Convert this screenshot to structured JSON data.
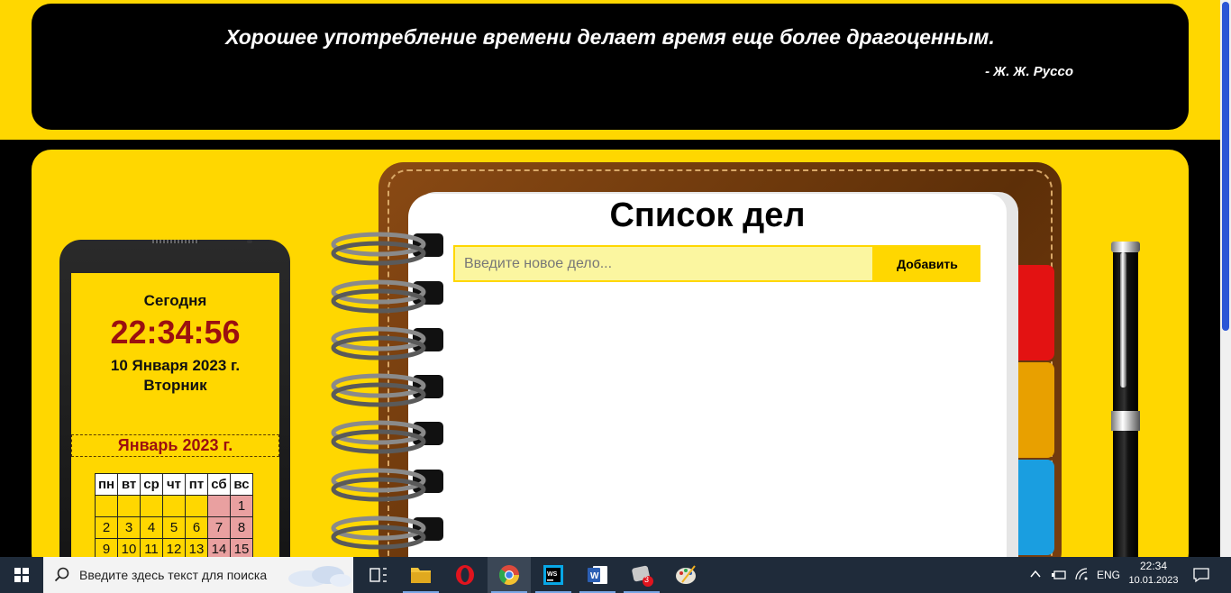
{
  "quote": {
    "text": "Хорошее употребление времени делает время еще более драгоценным.",
    "author": "- Ж. Ж. Руссо"
  },
  "clock_widget": {
    "today_label": "Сегодня",
    "time": "22:34:56",
    "date": "10 Января 2023 г.",
    "weekday": "Вторник"
  },
  "calendar": {
    "month_title": "Январь 2023 г.",
    "headers": [
      "пн",
      "вт",
      "ср",
      "чт",
      "пт",
      "сб",
      "вс"
    ],
    "rows": [
      [
        "",
        "",
        "",
        "",
        "",
        "",
        "1"
      ],
      [
        "2",
        "3",
        "4",
        "5",
        "6",
        "7",
        "8"
      ],
      [
        "9",
        "10",
        "11",
        "12",
        "13",
        "14",
        "15"
      ]
    ]
  },
  "todo": {
    "title": "Список дел",
    "input_placeholder": "Введите новое дело...",
    "add_label": "Добавить"
  },
  "taskbar": {
    "search_placeholder": "Введите здесь текст для поиска",
    "language": "ENG",
    "time": "22:34",
    "date": "10.01.2023",
    "badge_count": "3"
  },
  "colors": {
    "accent_yellow": "#FFD700",
    "clock_red": "#9b1010",
    "weekend_pink": "#e9a0a0",
    "tab_red": "#e31212",
    "tab_orange": "#e8a000",
    "tab_blue": "#1a9ee0"
  }
}
